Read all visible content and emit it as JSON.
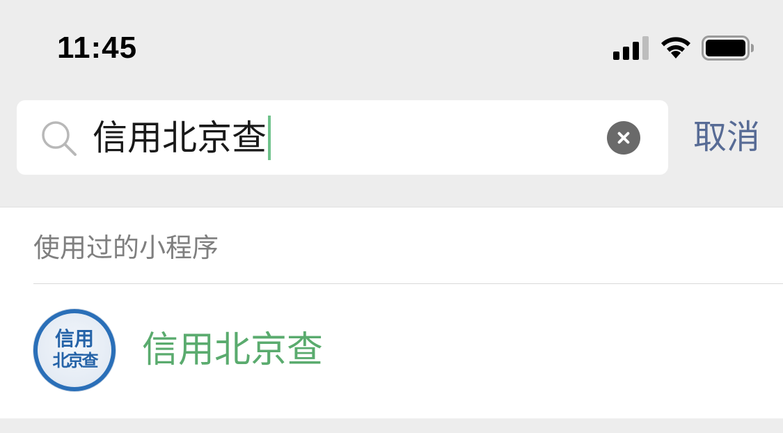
{
  "status_bar": {
    "time": "11:45",
    "icons": [
      "signal-icon",
      "wifi-icon",
      "battery-icon"
    ]
  },
  "search": {
    "query": "信用北京查",
    "cancel_label": "取消",
    "icons": [
      "search-icon",
      "clear-icon"
    ]
  },
  "results": {
    "section_title": "使用过的小程序",
    "items": [
      {
        "name": "信用北京查",
        "logo_text_line1": "信用",
        "logo_text_line2": "北京查"
      }
    ]
  },
  "colors": {
    "background": "#ededed",
    "cancel_link": "#576b95",
    "highlight_green": "#5aab6e",
    "caret": "#6fc28b",
    "logo_blue": "#2a6fb8"
  }
}
